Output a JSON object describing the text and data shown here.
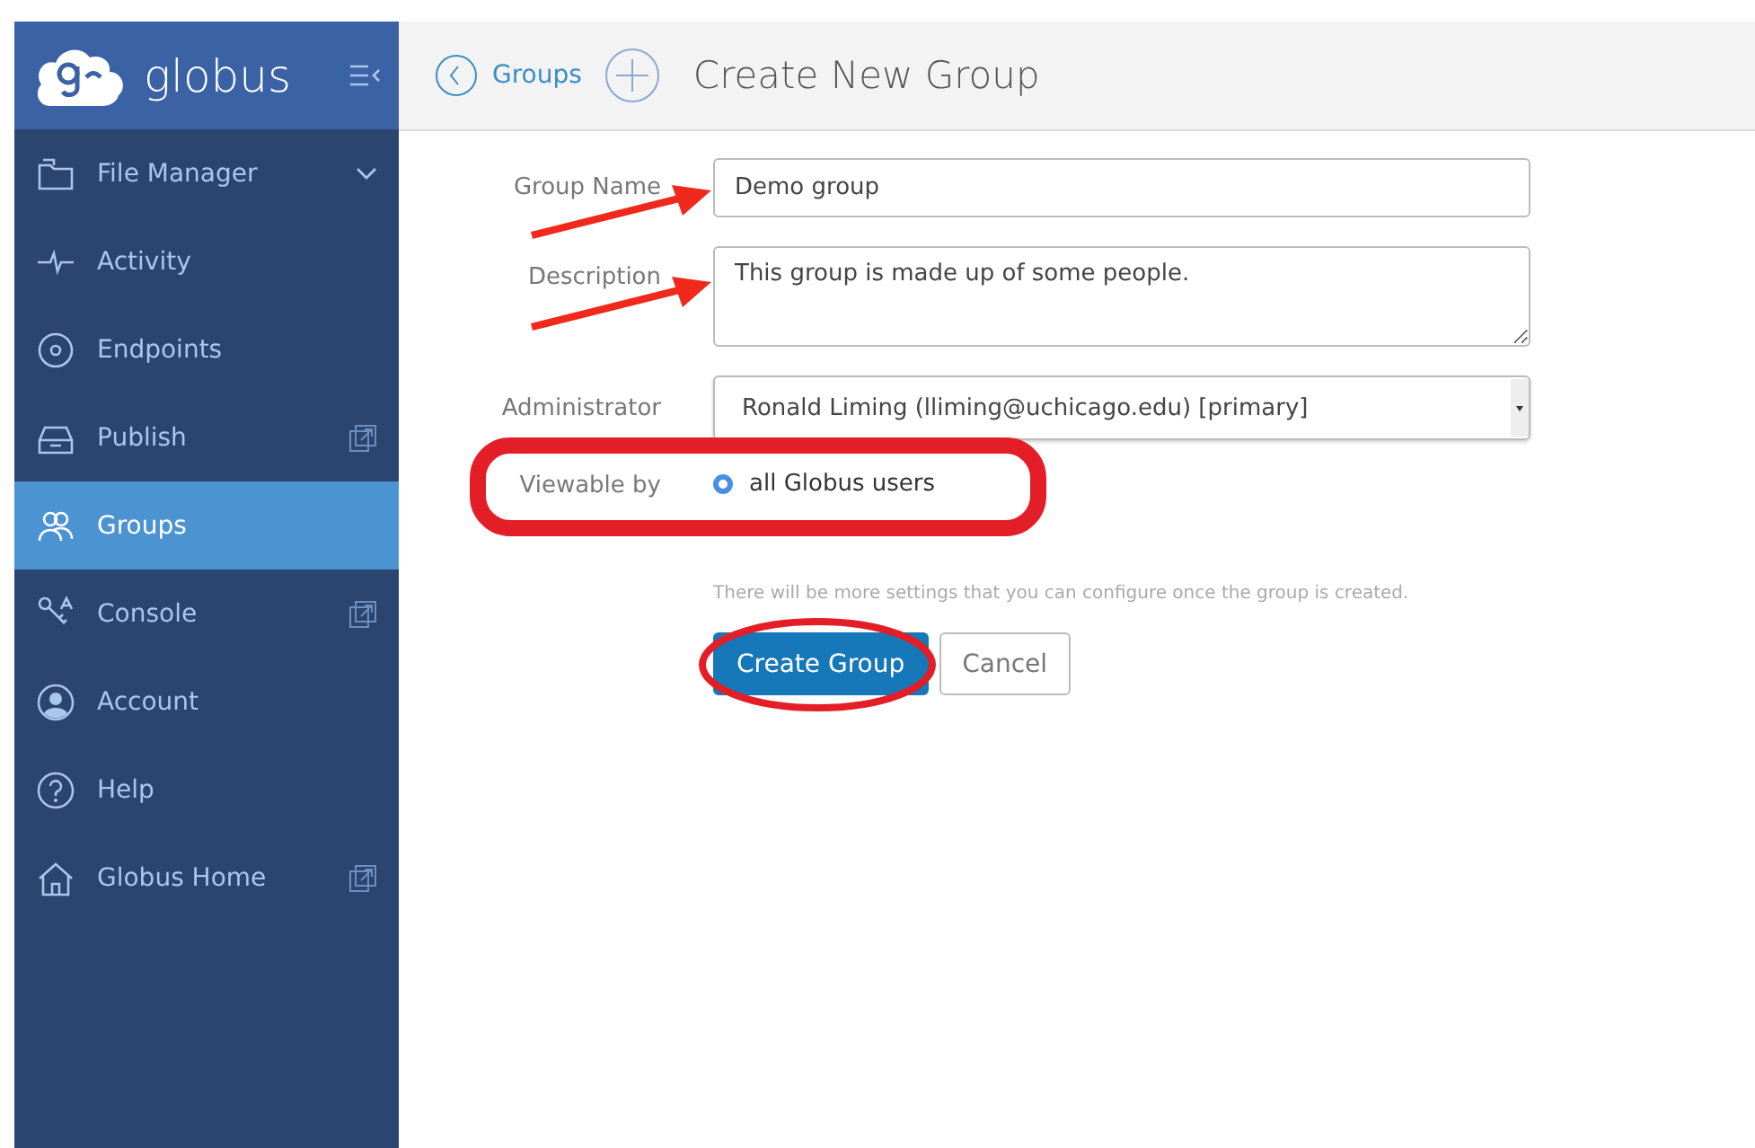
{
  "sidebar": {
    "brand": "globus",
    "items": [
      {
        "label": "File Manager",
        "selected": false,
        "expandable": true,
        "external": false
      },
      {
        "label": "Activity",
        "selected": false,
        "expandable": false,
        "external": false
      },
      {
        "label": "Endpoints",
        "selected": false,
        "expandable": false,
        "external": false
      },
      {
        "label": "Publish",
        "selected": false,
        "expandable": false,
        "external": true
      },
      {
        "label": "Groups",
        "selected": true,
        "expandable": false,
        "external": false
      },
      {
        "label": "Console",
        "selected": false,
        "expandable": false,
        "external": true
      },
      {
        "label": "Account",
        "selected": false,
        "expandable": false,
        "external": false
      },
      {
        "label": "Help",
        "selected": false,
        "expandable": false,
        "external": false
      },
      {
        "label": "Globus Home",
        "selected": false,
        "expandable": false,
        "external": true
      }
    ]
  },
  "header": {
    "back_link": "Groups",
    "title": "Create New Group"
  },
  "form": {
    "group_name": {
      "label": "Group Name",
      "value": "Demo group"
    },
    "description": {
      "label": "Description",
      "value": "This group is made up of some people."
    },
    "administrator": {
      "label": "Administrator",
      "value": "Ronald Liming (lliming@uchicago.edu) [primary]"
    },
    "viewable_by": {
      "label": "Viewable by",
      "options": [
        {
          "label": "all Globus users",
          "selected": true
        }
      ]
    },
    "hint": "There will be more settings that you can configure once the group is created.",
    "buttons": [
      {
        "label": "Create Group",
        "kind": "primary"
      },
      {
        "label": "Cancel",
        "kind": "secondary"
      }
    ]
  }
}
